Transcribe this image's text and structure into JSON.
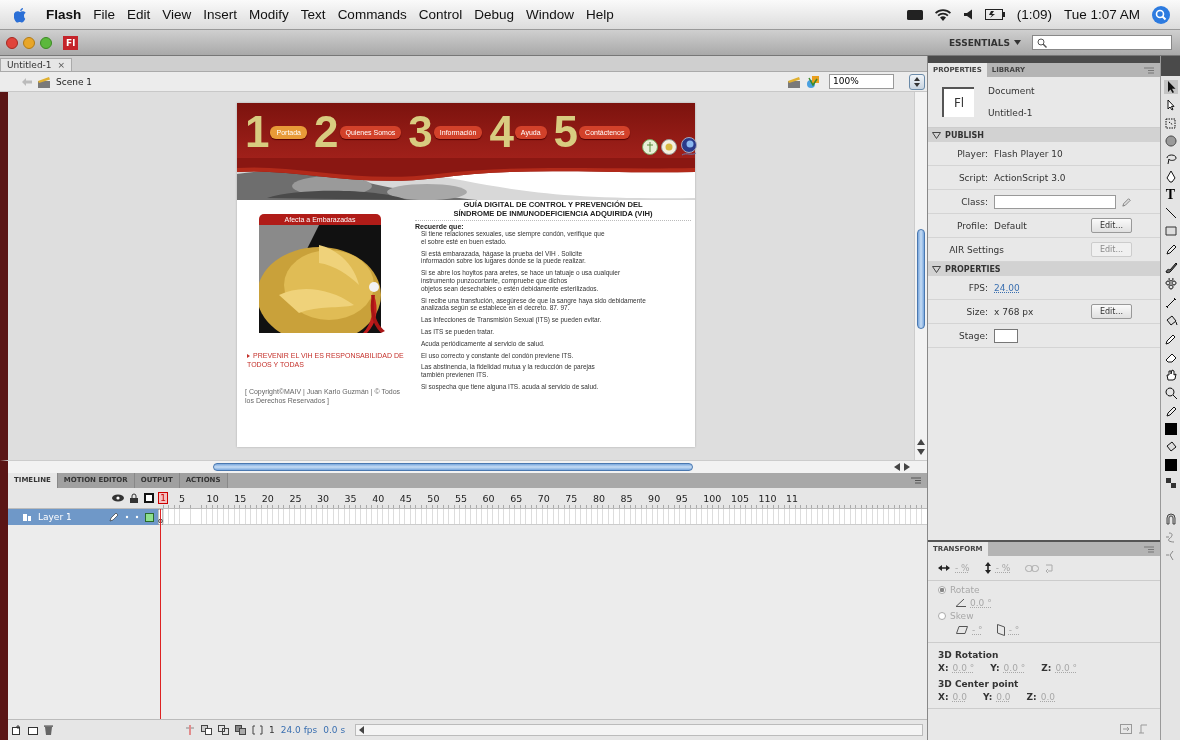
{
  "menu_bar": {
    "app": "Flash",
    "items": [
      "File",
      "Edit",
      "View",
      "Insert",
      "Modify",
      "Text",
      "Commands",
      "Control",
      "Debug",
      "Window",
      "Help"
    ],
    "battery": "(1:09)",
    "clock": "Tue 1:07 AM"
  },
  "title_bar": {
    "badge": "Fl",
    "workspace": "ESSENTIALS"
  },
  "document_tabs": [
    {
      "label": "Untitled-1",
      "close": "×",
      "selected": true
    }
  ],
  "scene_bar": {
    "scene": "Scene 1",
    "zoom": "100%"
  },
  "stage_page": {
    "nav": [
      {
        "number": "1",
        "label": "Portada",
        "selected": true
      },
      {
        "number": "2",
        "label": "Quienes Somos",
        "selected": false
      },
      {
        "number": "3",
        "label": "Información",
        "selected": false
      },
      {
        "number": "4",
        "label": "Ayuda",
        "selected": false
      },
      {
        "number": "5",
        "label": "Contáctenos",
        "selected": false
      }
    ],
    "title": "GUÍA DIGITAL DE CONTROL Y PREVENCIÓN DEL\nSÍNDROME DE INMUNODEFICIENCIA ADQUIRIDA (VIH)",
    "panel_title": "Afecta a Embarazadas",
    "slogan": "PREVENIR EL VIH ES RESPONSABILIDAD DE TODOS Y TODAS",
    "copyright": "[ Copyright©MAIV | Juan Karlo Guzmán | © Todos los Derechos Reservados ]",
    "intro": "Recuerde que:",
    "tips": [
      "Si tiene relaciones sexuales, use siempre condón, verifique que\nel sobre esté en buen estado.",
      "Si está embarazada, hágase la prueba del VIH . Solicite\ninformación sobre los lugares donde se la puede realizar.",
      "Si se abre los hoyitos para aretes, se hace un tatuaje o usa cualquier\ninstrumento punzocortante, compruebe que dichos\nobjetos sean desechables o estén debidamente esterilizados.",
      "Si recibe una transfución, asegúrese de que la sangre haya sido debidamente\nanalizada según se establece en el decreto. 87. 97.",
      "Las Infecciones de Transmisión Sexual (ITS)  se pueden evitar.",
      "Las ITS se pueden tratar.",
      "Acuda periódicamente al servicio de salud.",
      "El uso correcto y constante del condón previene ITS.",
      "Las abstinencia, la fidelidad mutua y la reducción de parejas\ntambién previenen ITS.",
      "Si sospecha que tiene alguna ITS. acuda al servicio de salud."
    ]
  },
  "timeline": {
    "tabs": [
      {
        "label": "TIMELINE",
        "selected": true
      },
      {
        "label": "MOTION EDITOR",
        "selected": false
      },
      {
        "label": "OUTPUT",
        "selected": false
      },
      {
        "label": "ACTIONS",
        "selected": false
      }
    ],
    "frame_numbers": [
      "5",
      "10",
      "15",
      "20",
      "25",
      "30",
      "35",
      "40",
      "45",
      "50",
      "55",
      "60",
      "65",
      "70",
      "75",
      "80",
      "85",
      "90",
      "95",
      "100",
      "105",
      "110",
      "11"
    ],
    "current_frame": "1",
    "layers": [
      {
        "name": "Layer 1",
        "selected": true
      }
    ],
    "status_frame": "1",
    "fps": "24.0 fps",
    "time": "0.0 s"
  },
  "properties": {
    "tabs": [
      {
        "label": "PROPERTIES",
        "selected": true
      },
      {
        "label": "LIBRARY",
        "selected": false
      }
    ],
    "doc_icon": "Fl",
    "doc_type": "Document",
    "doc_name": "Untitled-1",
    "sections": [
      {
        "title": "PUBLISH",
        "expanded": true,
        "rows": [
          {
            "kind": "text",
            "label": "Player:",
            "value": "Flash Player 10"
          },
          {
            "kind": "text",
            "label": "Script:",
            "value": "ActionScript 3.0"
          },
          {
            "kind": "field",
            "label": "Class:"
          },
          {
            "kind": "button",
            "label": "Profile:",
            "value": "Default",
            "button": "Edit...",
            "disabled": false
          },
          {
            "kind": "button",
            "label": "AIR Settings",
            "button": "Edit...",
            "disabled": true
          }
        ]
      },
      {
        "title": "PROPERTIES",
        "expanded": true,
        "rows": [
          {
            "kind": "link",
            "label": "FPS:",
            "value": "24.00"
          },
          {
            "kind": "button",
            "label": "Size:",
            "value": "x 768 px",
            "button": "Edit...",
            "disabled": false
          },
          {
            "kind": "swatch",
            "label": "Stage:"
          }
        ]
      }
    ]
  },
  "transform": {
    "title": "TRANSFORM",
    "disabled": true,
    "scale_w": "- %",
    "scale_h": "- %",
    "rotate": {
      "label": "Rotate",
      "selected": true,
      "value": "0.0 °"
    },
    "skew": {
      "label": "Skew",
      "selected": false,
      "h": "- °",
      "v": "- °"
    },
    "groups": [
      {
        "title": "3D Rotation",
        "axes": [
          {
            "label": "X:",
            "value": "0.0 °"
          },
          {
            "label": "Y:",
            "value": "0.0 °"
          },
          {
            "label": "Z:",
            "value": "0.0 °"
          }
        ]
      },
      {
        "title": "3D Center point",
        "axes": [
          {
            "label": "X:",
            "value": "0.0"
          },
          {
            "label": "Y:",
            "value": "0.0"
          },
          {
            "label": "Z:",
            "value": "0.0"
          }
        ]
      }
    ]
  },
  "tools": {
    "text_tool": "T"
  }
}
